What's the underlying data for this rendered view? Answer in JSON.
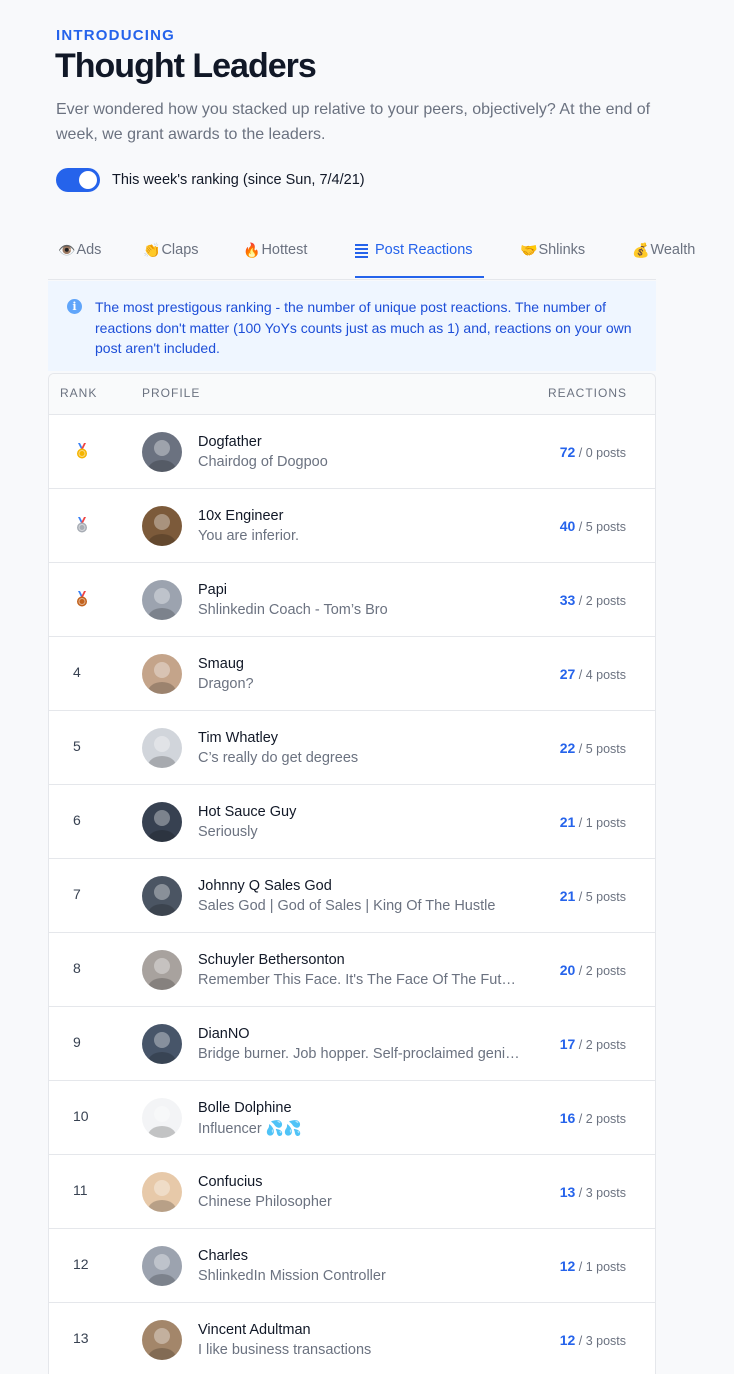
{
  "header": {
    "eyebrow": "INTRODUCING",
    "title": "Thought Leaders",
    "description": "Ever wondered how you stacked up relative to your peers, objectively? At the end of week, we grant awards to the leaders."
  },
  "toggle": {
    "label": "This week's ranking (since Sun, 7/4/21)",
    "on": true
  },
  "tabs": [
    {
      "icon": "👁️",
      "icon_name": "eye-icon",
      "label": "Ads"
    },
    {
      "icon": "👏",
      "icon_name": "clap-icon",
      "label": "Claps"
    },
    {
      "icon": "🔥",
      "icon_name": "fire-icon",
      "label": "Hottest"
    },
    {
      "icon": "",
      "icon_name": "list-icon",
      "label": "Post Reactions",
      "active": true
    },
    {
      "icon": "🤝",
      "icon_name": "handshake-icon",
      "label": "Shlinks"
    },
    {
      "icon": "💰",
      "icon_name": "money-bag-icon",
      "label": "Wealth"
    }
  ],
  "info": {
    "icon": "i",
    "text": "The most prestigous ranking - the number of unique post reactions. The number of reactions don't matter (100 YoYs counts just as much as 1) and, reactions on your own post aren't included."
  },
  "table": {
    "columns": {
      "rank": "RANK",
      "profile": "PROFILE",
      "reactions": "REACTIONS"
    },
    "rows": [
      {
        "rank": "",
        "medal": "gold",
        "name": "Dogfather",
        "subtitle": "Chairdog of Dogpoo",
        "reactions": "72",
        "posts": "/ 0 posts",
        "avatar_color": "#6b7280"
      },
      {
        "rank": "",
        "medal": "silver",
        "name": "10x Engineer",
        "subtitle": "You are inferior.",
        "reactions": "40",
        "posts": "/ 5 posts",
        "avatar_color": "#7c5a3a"
      },
      {
        "rank": "",
        "medal": "bronze",
        "name": "Papi",
        "subtitle": "Shlinkedin Coach - Tom’s Bro",
        "reactions": "33",
        "posts": "/ 2 posts",
        "avatar_color": "#9ca3af"
      },
      {
        "rank": "4",
        "medal": "",
        "name": "Smaug",
        "subtitle": "Dragon?",
        "reactions": "27",
        "posts": "/ 4 posts",
        "avatar_color": "#c4a48a"
      },
      {
        "rank": "5",
        "medal": "",
        "name": "Tim Whatley",
        "subtitle": "C’s really do get degrees",
        "reactions": "22",
        "posts": "/ 5 posts",
        "avatar_color": "#d1d5db"
      },
      {
        "rank": "6",
        "medal": "",
        "name": "Hot Sauce Guy",
        "subtitle": "Seriously",
        "reactions": "21",
        "posts": "/ 1 posts",
        "avatar_color": "#374151"
      },
      {
        "rank": "7",
        "medal": "",
        "name": "Johnny Q Sales God",
        "subtitle": "Sales God | God of Sales | King Of The Hustle",
        "reactions": "21",
        "posts": "/ 5 posts",
        "avatar_color": "#4b5563"
      },
      {
        "rank": "8",
        "medal": "",
        "name": "Schuyler Bethersonton",
        "subtitle": "Remember This Face. It's The Face Of The Future",
        "reactions": "20",
        "posts": "/ 2 posts",
        "avatar_color": "#a8a29e"
      },
      {
        "rank": "9",
        "medal": "",
        "name": "DianNO",
        "subtitle": "Bridge burner. Job hopper. Self-proclaimed genius",
        "reactions": "17",
        "posts": "/ 2 posts",
        "avatar_color": "#475569"
      },
      {
        "rank": "10",
        "medal": "",
        "name": "Bolle Dolphine",
        "subtitle": "Influencer 💦💦",
        "reactions": "16",
        "posts": "/ 2 posts",
        "avatar_color": "#f3f4f6"
      },
      {
        "rank": "11",
        "medal": "",
        "name": "Confucius",
        "subtitle": "Chinese Philosopher",
        "reactions": "13",
        "posts": "/ 3 posts",
        "avatar_color": "#e7c9a9"
      },
      {
        "rank": "12",
        "medal": "",
        "name": "Charles",
        "subtitle": "ShlinkedIn Mission Controller",
        "reactions": "12",
        "posts": "/ 1 posts",
        "avatar_color": "#9ca3af"
      },
      {
        "rank": "13",
        "medal": "",
        "name": "Vincent Adultman",
        "subtitle": "I like business transactions",
        "reactions": "12",
        "posts": "/ 3 posts",
        "avatar_color": "#a3866a"
      }
    ]
  },
  "colors": {
    "accent": "#2563eb",
    "info_bg": "#eff6ff",
    "gold": "#f5b400",
    "silver": "#a8adb5",
    "bronze": "#c2621d"
  }
}
